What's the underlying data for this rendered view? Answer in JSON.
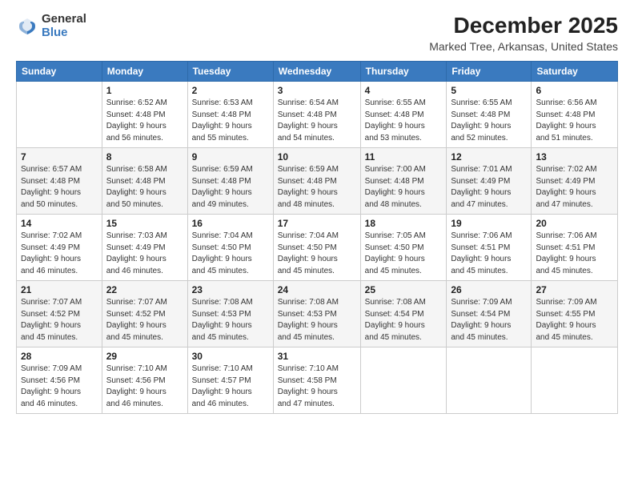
{
  "header": {
    "logo_general": "General",
    "logo_blue": "Blue",
    "title": "December 2025",
    "subtitle": "Marked Tree, Arkansas, United States"
  },
  "days_of_week": [
    "Sunday",
    "Monday",
    "Tuesday",
    "Wednesday",
    "Thursday",
    "Friday",
    "Saturday"
  ],
  "weeks": [
    [
      {
        "day": "",
        "info": ""
      },
      {
        "day": "1",
        "info": "Sunrise: 6:52 AM\nSunset: 4:48 PM\nDaylight: 9 hours\nand 56 minutes."
      },
      {
        "day": "2",
        "info": "Sunrise: 6:53 AM\nSunset: 4:48 PM\nDaylight: 9 hours\nand 55 minutes."
      },
      {
        "day": "3",
        "info": "Sunrise: 6:54 AM\nSunset: 4:48 PM\nDaylight: 9 hours\nand 54 minutes."
      },
      {
        "day": "4",
        "info": "Sunrise: 6:55 AM\nSunset: 4:48 PM\nDaylight: 9 hours\nand 53 minutes."
      },
      {
        "day": "5",
        "info": "Sunrise: 6:55 AM\nSunset: 4:48 PM\nDaylight: 9 hours\nand 52 minutes."
      },
      {
        "day": "6",
        "info": "Sunrise: 6:56 AM\nSunset: 4:48 PM\nDaylight: 9 hours\nand 51 minutes."
      }
    ],
    [
      {
        "day": "7",
        "info": "Sunrise: 6:57 AM\nSunset: 4:48 PM\nDaylight: 9 hours\nand 50 minutes."
      },
      {
        "day": "8",
        "info": "Sunrise: 6:58 AM\nSunset: 4:48 PM\nDaylight: 9 hours\nand 50 minutes."
      },
      {
        "day": "9",
        "info": "Sunrise: 6:59 AM\nSunset: 4:48 PM\nDaylight: 9 hours\nand 49 minutes."
      },
      {
        "day": "10",
        "info": "Sunrise: 6:59 AM\nSunset: 4:48 PM\nDaylight: 9 hours\nand 48 minutes."
      },
      {
        "day": "11",
        "info": "Sunrise: 7:00 AM\nSunset: 4:48 PM\nDaylight: 9 hours\nand 48 minutes."
      },
      {
        "day": "12",
        "info": "Sunrise: 7:01 AM\nSunset: 4:49 PM\nDaylight: 9 hours\nand 47 minutes."
      },
      {
        "day": "13",
        "info": "Sunrise: 7:02 AM\nSunset: 4:49 PM\nDaylight: 9 hours\nand 47 minutes."
      }
    ],
    [
      {
        "day": "14",
        "info": "Sunrise: 7:02 AM\nSunset: 4:49 PM\nDaylight: 9 hours\nand 46 minutes."
      },
      {
        "day": "15",
        "info": "Sunrise: 7:03 AM\nSunset: 4:49 PM\nDaylight: 9 hours\nand 46 minutes."
      },
      {
        "day": "16",
        "info": "Sunrise: 7:04 AM\nSunset: 4:50 PM\nDaylight: 9 hours\nand 45 minutes."
      },
      {
        "day": "17",
        "info": "Sunrise: 7:04 AM\nSunset: 4:50 PM\nDaylight: 9 hours\nand 45 minutes."
      },
      {
        "day": "18",
        "info": "Sunrise: 7:05 AM\nSunset: 4:50 PM\nDaylight: 9 hours\nand 45 minutes."
      },
      {
        "day": "19",
        "info": "Sunrise: 7:06 AM\nSunset: 4:51 PM\nDaylight: 9 hours\nand 45 minutes."
      },
      {
        "day": "20",
        "info": "Sunrise: 7:06 AM\nSunset: 4:51 PM\nDaylight: 9 hours\nand 45 minutes."
      }
    ],
    [
      {
        "day": "21",
        "info": "Sunrise: 7:07 AM\nSunset: 4:52 PM\nDaylight: 9 hours\nand 45 minutes."
      },
      {
        "day": "22",
        "info": "Sunrise: 7:07 AM\nSunset: 4:52 PM\nDaylight: 9 hours\nand 45 minutes."
      },
      {
        "day": "23",
        "info": "Sunrise: 7:08 AM\nSunset: 4:53 PM\nDaylight: 9 hours\nand 45 minutes."
      },
      {
        "day": "24",
        "info": "Sunrise: 7:08 AM\nSunset: 4:53 PM\nDaylight: 9 hours\nand 45 minutes."
      },
      {
        "day": "25",
        "info": "Sunrise: 7:08 AM\nSunset: 4:54 PM\nDaylight: 9 hours\nand 45 minutes."
      },
      {
        "day": "26",
        "info": "Sunrise: 7:09 AM\nSunset: 4:54 PM\nDaylight: 9 hours\nand 45 minutes."
      },
      {
        "day": "27",
        "info": "Sunrise: 7:09 AM\nSunset: 4:55 PM\nDaylight: 9 hours\nand 45 minutes."
      }
    ],
    [
      {
        "day": "28",
        "info": "Sunrise: 7:09 AM\nSunset: 4:56 PM\nDaylight: 9 hours\nand 46 minutes."
      },
      {
        "day": "29",
        "info": "Sunrise: 7:10 AM\nSunset: 4:56 PM\nDaylight: 9 hours\nand 46 minutes."
      },
      {
        "day": "30",
        "info": "Sunrise: 7:10 AM\nSunset: 4:57 PM\nDaylight: 9 hours\nand 46 minutes."
      },
      {
        "day": "31",
        "info": "Sunrise: 7:10 AM\nSunset: 4:58 PM\nDaylight: 9 hours\nand 47 minutes."
      },
      {
        "day": "",
        "info": ""
      },
      {
        "day": "",
        "info": ""
      },
      {
        "day": "",
        "info": ""
      }
    ]
  ]
}
